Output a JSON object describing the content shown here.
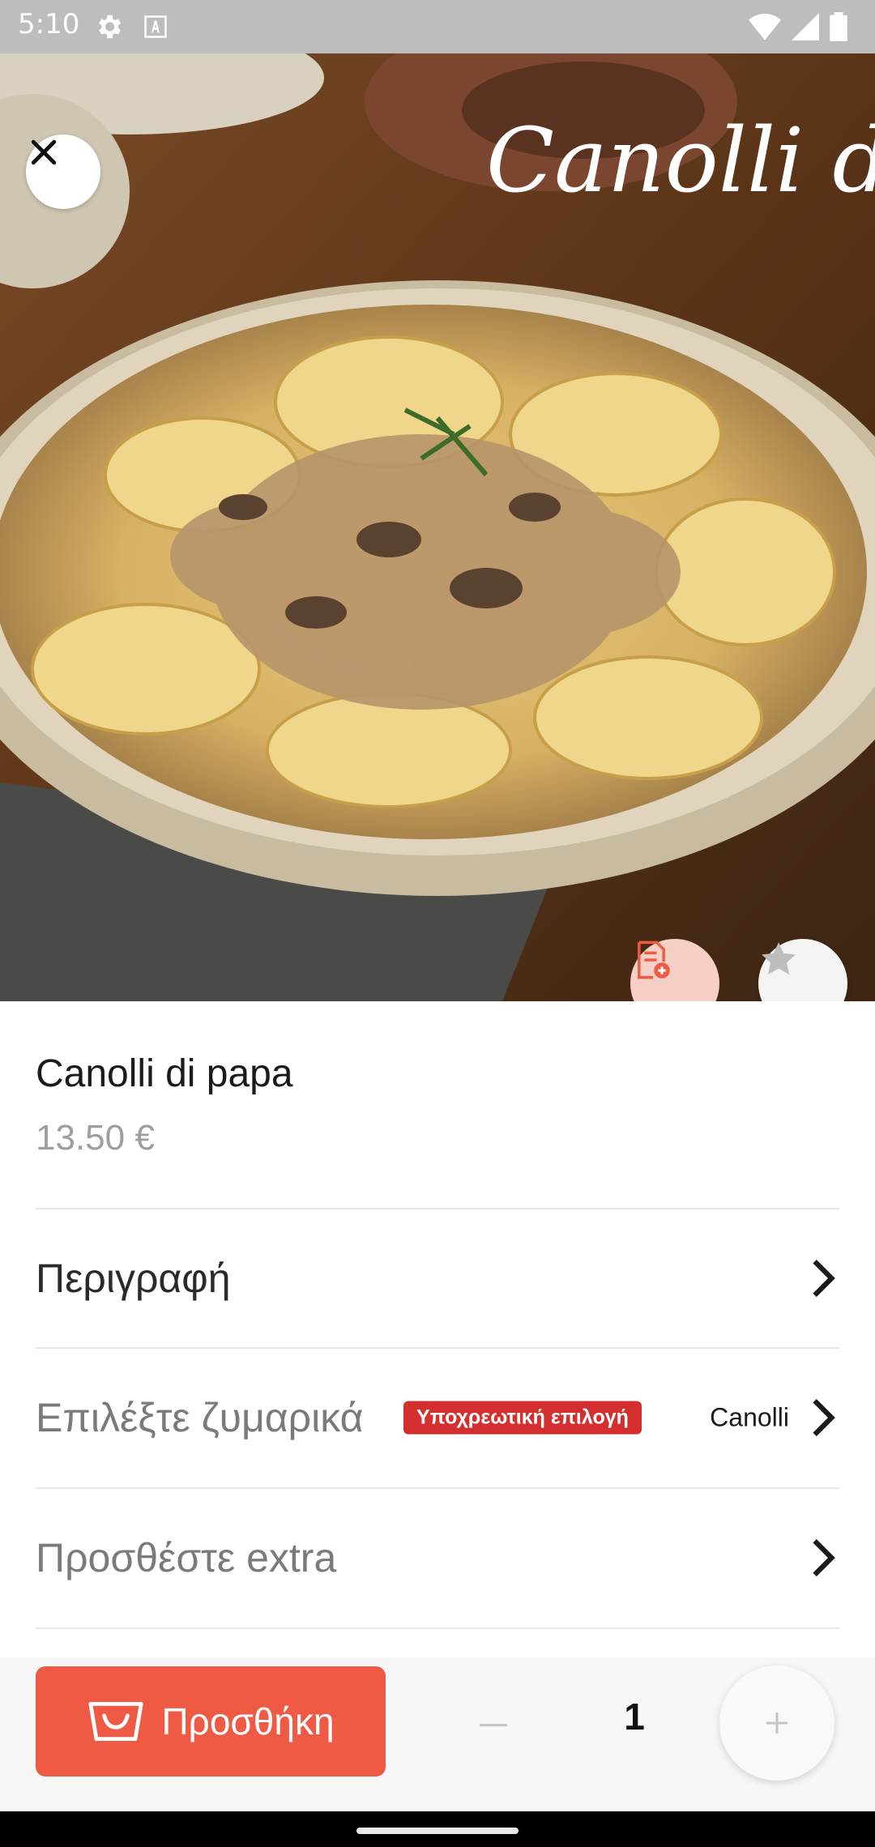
{
  "status_bar": {
    "time": "5:10"
  },
  "hero": {
    "overlay_text": "Canolli di "
  },
  "product": {
    "name": "Canolli di papa",
    "price": "13.50 €"
  },
  "options": [
    {
      "label": "Περιγραφή",
      "badge": "",
      "value": ""
    },
    {
      "label": "Επιλέξτε ζυμαρικά",
      "badge": "Υποχρεωτική επιλογή",
      "value": "Canolli"
    },
    {
      "label": "Προσθέστε extra",
      "badge": "",
      "value": ""
    }
  ],
  "cart": {
    "add_label": "Προσθήκη",
    "quantity": "1"
  },
  "colors": {
    "accent": "#ef5a45",
    "badge": "#d32f2f",
    "price": "#9e9e9e"
  },
  "icons": [
    "settings-icon",
    "keyboard-icon",
    "wifi-icon",
    "signal-icon",
    "battery-icon",
    "close-icon",
    "add-note-icon",
    "star-icon",
    "chevron-right-icon",
    "basket-icon",
    "minus-icon",
    "plus-icon"
  ]
}
